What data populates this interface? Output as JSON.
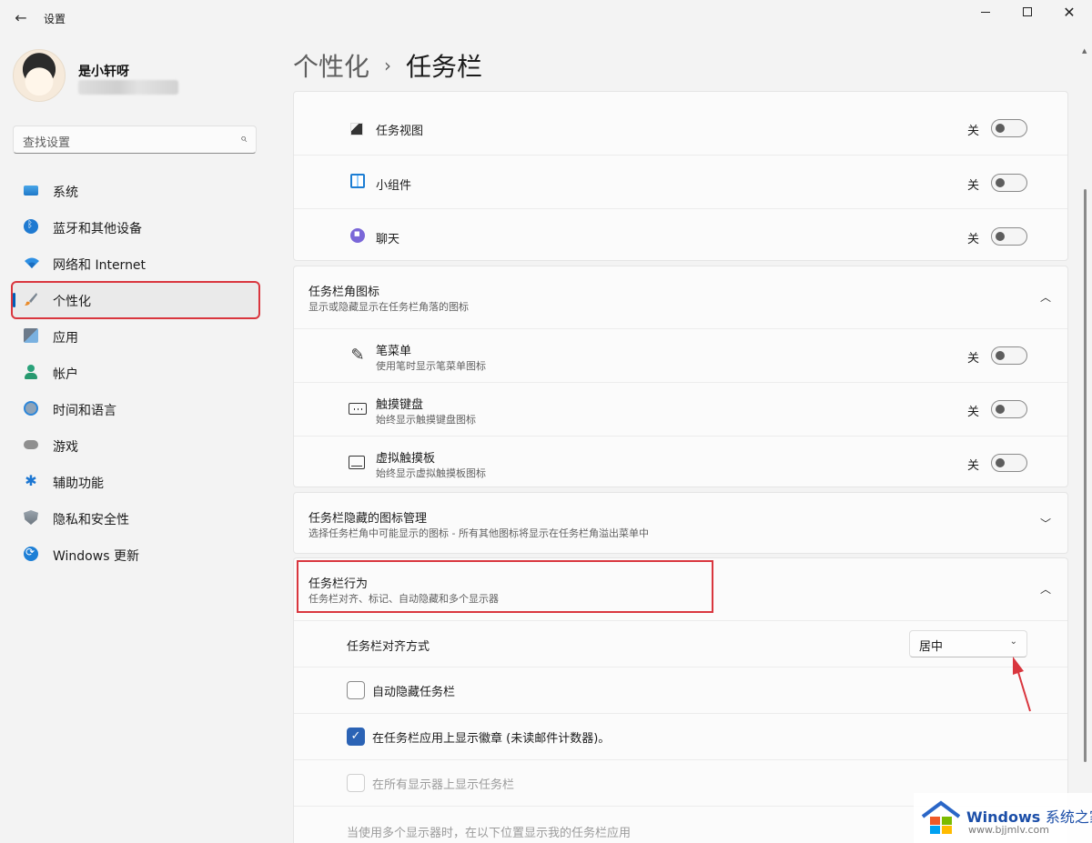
{
  "window": {
    "title": "设置",
    "back_icon": "←",
    "close_icon": "✕"
  },
  "user": {
    "name": "是小轩呀"
  },
  "search": {
    "placeholder": "查找设置",
    "icon": "⌕"
  },
  "sidebar": {
    "items": [
      {
        "label": "系统",
        "icon": "system-icon"
      },
      {
        "label": "蓝牙和其他设备",
        "icon": "bluetooth-icon"
      },
      {
        "label": "网络和 Internet",
        "icon": "wifi-icon"
      },
      {
        "label": "个性化",
        "icon": "brush-icon",
        "active": true
      },
      {
        "label": "应用",
        "icon": "apps-icon"
      },
      {
        "label": "帐户",
        "icon": "account-icon"
      },
      {
        "label": "时间和语言",
        "icon": "clock-globe-icon"
      },
      {
        "label": "游戏",
        "icon": "gamepad-icon"
      },
      {
        "label": "辅助功能",
        "icon": "accessibility-icon"
      },
      {
        "label": "隐私和安全性",
        "icon": "shield-icon"
      },
      {
        "label": "Windows 更新",
        "icon": "update-icon"
      }
    ]
  },
  "breadcrumb": {
    "parent": "个性化",
    "separator": "›",
    "current": "任务栏"
  },
  "taskbar_items": [
    {
      "title": "任务视图",
      "state": "关",
      "icon": "task-view-icon"
    },
    {
      "title": "小组件",
      "state": "关",
      "icon": "widgets-icon"
    },
    {
      "title": "聊天",
      "state": "关",
      "icon": "chat-icon"
    }
  ],
  "corner_icons": {
    "title": "任务栏角图标",
    "subtitle": "显示或隐藏显示在任务栏角落的图标",
    "chevron": "︿",
    "items": [
      {
        "title": "笔菜单",
        "subtitle": "使用笔时显示笔菜单图标",
        "state": "关",
        "icon": "pen-icon"
      },
      {
        "title": "触摸键盘",
        "subtitle": "始终显示触摸键盘图标",
        "state": "关",
        "icon": "keyboard-icon"
      },
      {
        "title": "虚拟触摸板",
        "subtitle": "始终显示虚拟触摸板图标",
        "state": "关",
        "icon": "touchpad-icon"
      }
    ]
  },
  "overflow": {
    "title": "任务栏隐藏的图标管理",
    "subtitle": "选择任务栏角中可能显示的图标 - 所有其他图标将显示在任务栏角溢出菜单中",
    "chevron": "﹀"
  },
  "behaviors": {
    "title": "任务栏行为",
    "subtitle": "任务栏对齐、标记、自动隐藏和多个显示器",
    "chevron": "︿",
    "alignment": {
      "label": "任务栏对齐方式",
      "value": "居中",
      "caret": "⌄"
    },
    "options": [
      {
        "label": "自动隐藏任务栏",
        "checked": false,
        "disabled": false
      },
      {
        "label": "在任务栏应用上显示徽章 (未读邮件计数器)。",
        "checked": true,
        "disabled": false
      },
      {
        "label": "在所有显示器上显示任务栏",
        "checked": false,
        "disabled": true
      }
    ],
    "multi_display_hint": "当使用多个显示器时，在以下位置显示我的任务栏应用"
  },
  "watermark": {
    "brand": "Windows",
    "accent": "系统之家",
    "url": "www.bjjmlv.com"
  },
  "colors": {
    "accent": "#005fb8",
    "highlight_red": "#d9363e",
    "checkbox_blue": "#2b63b5",
    "background": "#f3f3f3",
    "card": "#fbfbfb"
  }
}
